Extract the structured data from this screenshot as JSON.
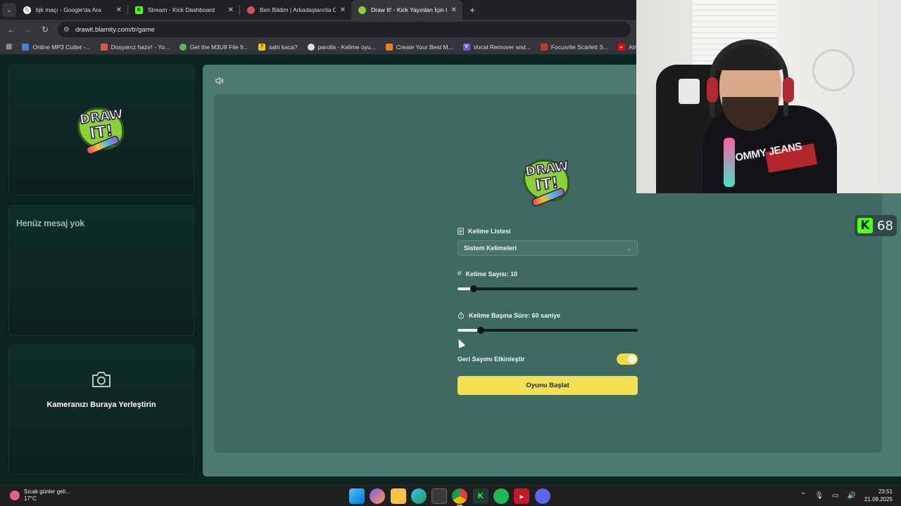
{
  "browser": {
    "tabs": [
      {
        "title": "bjk maçı - Google'da Ara",
        "icon": "google-icon",
        "color": "#ffffff"
      },
      {
        "title": "Stream - Kick Dashboard",
        "icon": "kick-icon",
        "color": "#53fc18"
      },
      {
        "title": "Ben Bildim | Arkadaşlarınla Onl",
        "icon": "benbildim-icon",
        "color": "#d9534f"
      },
      {
        "title": "Draw It! - Kick Yayınları İçin Çizi",
        "icon": "drawit-icon",
        "color": "#8bd03a"
      }
    ],
    "url": "drawit.blamity.com/tr/game",
    "bookmarks": [
      {
        "label": "Online MP3 Cutter -...",
        "color": "#4a7bdc"
      },
      {
        "label": "Dosyanız hazır! - Yo...",
        "color": "#d9534f"
      },
      {
        "label": "Get the M3U8 File fr...",
        "color": "#5cb85c"
      },
      {
        "label": "sahi kaca?",
        "color": "#f0c419"
      },
      {
        "label": "parolla - Kelime oyu...",
        "color": "#888888"
      },
      {
        "label": "Create Your Best M...",
        "color": "#e67e22"
      },
      {
        "label": "Vocal Remover and...",
        "color": "#6c5ce7"
      },
      {
        "label": "Focusrite Scarlett S...",
        "color": "#c0392b"
      },
      {
        "label": "Atma - YouTube",
        "color": "#ff0000"
      }
    ]
  },
  "sidebar": {
    "chat_empty": "Henüz mesaj yok",
    "camera_label": "Kameranızı Buraya Yerleştirin"
  },
  "logo": {
    "line1": "DRAW",
    "line2": "IT!"
  },
  "settings": {
    "word_list_label": "Kelime Listesi",
    "word_list_value": "Sistem Kelimeleri",
    "word_count_label": "Kelime Sayısı: 10",
    "word_count_fraction": 0.09,
    "time_label": "Kelime Başına Süre: 60 saniye",
    "time_fraction": 0.13,
    "countdown_label": "Geri Sayımı Etkinleştir",
    "countdown_enabled": true,
    "start_button": "Oyunu Başlat"
  },
  "overlay": {
    "shirt_text": "OMMY JEANS",
    "viewer_count": "68"
  },
  "taskbar": {
    "weather_text": "Sıcak günler geli...",
    "weather_temp": "17°C",
    "time": "23:51",
    "date": "21.08.2025"
  },
  "colors": {
    "accent_yellow": "#f5df52",
    "board_bg": "#3f6a61",
    "kick_green": "#53fc18"
  }
}
